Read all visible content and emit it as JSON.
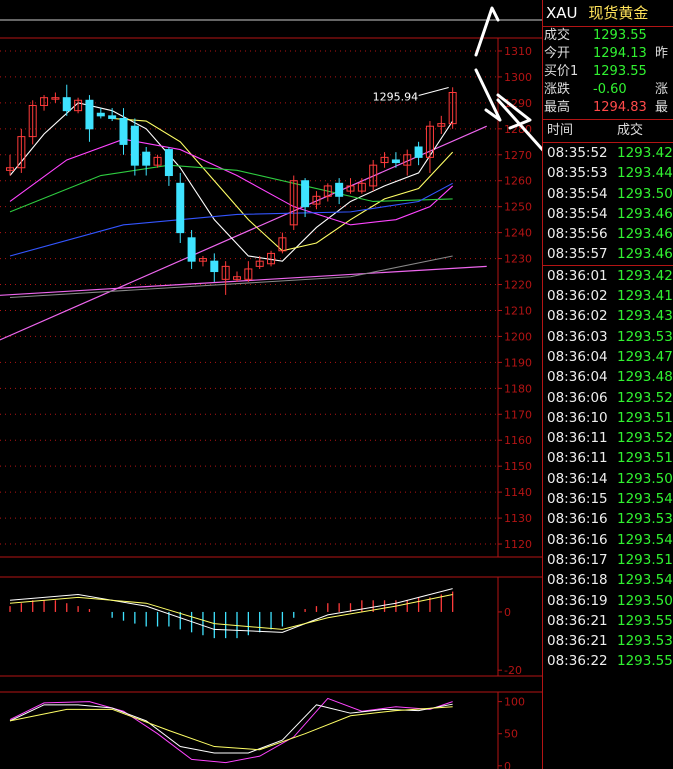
{
  "quote": {
    "symbol": "XAU",
    "name": "现货黄金",
    "rows": [
      {
        "label": "成交",
        "value": "1293.55",
        "extra": "",
        "color": "green"
      },
      {
        "label": "今开",
        "value": "1294.13",
        "extra": "昨",
        "color": "green"
      },
      {
        "label": "买价1",
        "value": "1293.55",
        "extra": "",
        "color": "green"
      },
      {
        "label": "涨跌",
        "value": "-0.60",
        "extra": "涨",
        "color": "green"
      },
      {
        "label": "最高",
        "value": "1294.83",
        "extra": "最",
        "color": "red"
      }
    ]
  },
  "ticks": {
    "header_time": "时间",
    "header_price": "成交",
    "rows": [
      {
        "time": "08:35:52",
        "price": "1293.42"
      },
      {
        "time": "08:35:53",
        "price": "1293.44"
      },
      {
        "time": "08:35:54",
        "price": "1293.50"
      },
      {
        "time": "08:35:54",
        "price": "1293.46"
      },
      {
        "time": "08:35:56",
        "price": "1293.46"
      },
      {
        "time": "08:35:57",
        "price": "1293.46"
      },
      {
        "time": "08:36:01",
        "price": "1293.42"
      },
      {
        "time": "08:36:02",
        "price": "1293.41"
      },
      {
        "time": "08:36:02",
        "price": "1293.43"
      },
      {
        "time": "08:36:03",
        "price": "1293.53"
      },
      {
        "time": "08:36:04",
        "price": "1293.47"
      },
      {
        "time": "08:36:04",
        "price": "1293.48"
      },
      {
        "time": "08:36:06",
        "price": "1293.52"
      },
      {
        "time": "08:36:10",
        "price": "1293.51"
      },
      {
        "time": "08:36:11",
        "price": "1293.52"
      },
      {
        "time": "08:36:11",
        "price": "1293.51"
      },
      {
        "time": "08:36:14",
        "price": "1293.50"
      },
      {
        "time": "08:36:15",
        "price": "1293.54"
      },
      {
        "time": "08:36:16",
        "price": "1293.53"
      },
      {
        "time": "08:36:16",
        "price": "1293.54"
      },
      {
        "time": "08:36:17",
        "price": "1293.51"
      },
      {
        "time": "08:36:18",
        "price": "1293.54"
      },
      {
        "time": "08:36:19",
        "price": "1293.50"
      },
      {
        "time": "08:36:21",
        "price": "1293.55"
      },
      {
        "time": "08:36:21",
        "price": "1293.53"
      },
      {
        "time": "08:36:22",
        "price": "1293.55"
      }
    ]
  },
  "colors": {
    "up": "#ff3b3b",
    "down": "#3fe3ff",
    "grid": "#b31414",
    "ma5": "#ffffff",
    "ma10": "#ffff66",
    "ma20": "#ff44ff",
    "ma30": "#2ecc40",
    "ma60": "#3355ff",
    "ma120": "#888888",
    "trendline": "#ee66ee"
  },
  "chart_data": [
    {
      "type": "candlestick",
      "ylim": [
        1115,
        1315
      ],
      "yticks": [
        1310,
        1300,
        1290,
        1280,
        1270,
        1260,
        1250,
        1240,
        1230,
        1220,
        1210,
        1200,
        1190,
        1180,
        1170,
        1160,
        1150,
        1140,
        1130,
        1120
      ],
      "annotation": "1295.94",
      "annotation_value": 1295.94,
      "candles": [
        {
          "o": 1264,
          "h": 1270,
          "l": 1262,
          "c": 1265
        },
        {
          "o": 1265,
          "h": 1280,
          "l": 1263,
          "c": 1277
        },
        {
          "o": 1277,
          "h": 1291,
          "l": 1274,
          "c": 1289
        },
        {
          "o": 1289,
          "h": 1293,
          "l": 1287,
          "c": 1292
        },
        {
          "o": 1292,
          "h": 1294,
          "l": 1290,
          "c": 1292
        },
        {
          "o": 1292,
          "h": 1297,
          "l": 1285,
          "c": 1287
        },
        {
          "o": 1287,
          "h": 1292,
          "l": 1286,
          "c": 1291
        },
        {
          "o": 1291,
          "h": 1293,
          "l": 1275,
          "c": 1280
        },
        {
          "o": 1286,
          "h": 1288,
          "l": 1284,
          "c": 1285
        },
        {
          "o": 1285,
          "h": 1288,
          "l": 1283,
          "c": 1284
        },
        {
          "o": 1284,
          "h": 1288,
          "l": 1270,
          "c": 1274
        },
        {
          "o": 1281,
          "h": 1284,
          "l": 1262,
          "c": 1266
        },
        {
          "o": 1271,
          "h": 1273,
          "l": 1262,
          "c": 1266
        },
        {
          "o": 1266,
          "h": 1270,
          "l": 1265,
          "c": 1269
        },
        {
          "o": 1272,
          "h": 1273,
          "l": 1258,
          "c": 1262
        },
        {
          "o": 1259,
          "h": 1263,
          "l": 1236,
          "c": 1240
        },
        {
          "o": 1238,
          "h": 1241,
          "l": 1226,
          "c": 1229
        },
        {
          "o": 1229,
          "h": 1231,
          "l": 1227,
          "c": 1230
        },
        {
          "o": 1229,
          "h": 1232,
          "l": 1221,
          "c": 1225
        },
        {
          "o": 1222,
          "h": 1229,
          "l": 1216,
          "c": 1227
        },
        {
          "o": 1222,
          "h": 1225,
          "l": 1221,
          "c": 1223
        },
        {
          "o": 1222,
          "h": 1229,
          "l": 1221,
          "c": 1226
        },
        {
          "o": 1227,
          "h": 1231,
          "l": 1226,
          "c": 1229
        },
        {
          "o": 1228,
          "h": 1233,
          "l": 1227,
          "c": 1232
        },
        {
          "o": 1233,
          "h": 1240,
          "l": 1232,
          "c": 1238
        },
        {
          "o": 1243,
          "h": 1262,
          "l": 1241,
          "c": 1260
        },
        {
          "o": 1260,
          "h": 1261,
          "l": 1246,
          "c": 1250
        },
        {
          "o": 1251,
          "h": 1256,
          "l": 1249,
          "c": 1254
        },
        {
          "o": 1254,
          "h": 1259,
          "l": 1252,
          "c": 1258
        },
        {
          "o": 1259,
          "h": 1261,
          "l": 1251,
          "c": 1254
        },
        {
          "o": 1256,
          "h": 1261,
          "l": 1255,
          "c": 1258
        },
        {
          "o": 1256,
          "h": 1261,
          "l": 1255,
          "c": 1259
        },
        {
          "o": 1258,
          "h": 1268,
          "l": 1256,
          "c": 1266
        },
        {
          "o": 1267,
          "h": 1271,
          "l": 1265,
          "c": 1269
        },
        {
          "o": 1268,
          "h": 1271,
          "l": 1265,
          "c": 1267
        },
        {
          "o": 1266,
          "h": 1272,
          "l": 1262,
          "c": 1270
        },
        {
          "o": 1273,
          "h": 1275,
          "l": 1266,
          "c": 1269
        },
        {
          "o": 1269,
          "h": 1283,
          "l": 1263,
          "c": 1281
        },
        {
          "o": 1281,
          "h": 1285,
          "l": 1278,
          "c": 1282
        },
        {
          "o": 1282,
          "h": 1296,
          "l": 1280,
          "c": 1294
        }
      ],
      "ma": [
        {
          "name": "MA5",
          "key": "ma5",
          "points": [
            [
              0,
              1262
            ],
            [
              3,
              1278
            ],
            [
              6,
              1290
            ],
            [
              9,
              1287
            ],
            [
              12,
              1280
            ],
            [
              15,
              1265
            ],
            [
              18,
              1245
            ],
            [
              21,
              1231
            ],
            [
              24,
              1229
            ],
            [
              27,
              1242
            ],
            [
              30,
              1252
            ],
            [
              33,
              1258
            ],
            [
              36,
              1263
            ],
            [
              39,
              1283
            ]
          ]
        },
        {
          "name": "MA10",
          "key": "ma10",
          "points": [
            [
              9,
              1284
            ],
            [
              12,
              1283
            ],
            [
              15,
              1275
            ],
            [
              18,
              1260
            ],
            [
              21,
              1245
            ],
            [
              24,
              1233
            ],
            [
              27,
              1236
            ],
            [
              30,
              1245
            ],
            [
              33,
              1253
            ],
            [
              36,
              1257
            ],
            [
              39,
              1271
            ]
          ]
        },
        {
          "name": "MA20",
          "key": "ma20",
          "points": [
            [
              0,
              1252
            ],
            [
              5,
              1268
            ],
            [
              10,
              1276
            ],
            [
              15,
              1272
            ],
            [
              20,
              1262
            ],
            [
              25,
              1250
            ],
            [
              30,
              1243
            ],
            [
              34,
              1245
            ],
            [
              37,
              1250
            ],
            [
              39,
              1258
            ]
          ]
        },
        {
          "name": "MA30",
          "key": "ma30",
          "points": [
            [
              0,
              1248
            ],
            [
              8,
              1262
            ],
            [
              14,
              1266
            ],
            [
              20,
              1264
            ],
            [
              26,
              1258
            ],
            [
              32,
              1252
            ],
            [
              39,
              1253
            ]
          ]
        },
        {
          "name": "MA60",
          "key": "ma60",
          "points": [
            [
              0,
              1231
            ],
            [
              10,
              1243
            ],
            [
              20,
              1247
            ],
            [
              30,
              1248
            ],
            [
              36,
              1252
            ],
            [
              39,
              1259
            ]
          ]
        },
        {
          "name": "MA120",
          "key": "ma120",
          "points": [
            [
              0,
              1215
            ],
            [
              15,
              1219
            ],
            [
              30,
              1223
            ],
            [
              39,
              1231
            ]
          ]
        }
      ],
      "trendlines": [
        {
          "from": [
            -8,
            1185
          ],
          "to": [
            42,
            1281
          ]
        },
        {
          "from": [
            -8,
            1214
          ],
          "to": [
            42,
            1227
          ]
        }
      ]
    },
    {
      "type": "bar",
      "indicator": "MACD",
      "ylim": [
        -22,
        12
      ],
      "yticks": [
        0,
        -20
      ],
      "values": [
        2,
        3,
        4,
        4,
        4,
        3,
        2,
        1,
        0,
        -2,
        -3,
        -4,
        -5,
        -5,
        -5,
        -6,
        -7,
        -8,
        -9,
        -9,
        -9,
        -8,
        -7,
        -6,
        -5,
        -2,
        1,
        2,
        3,
        3,
        3,
        4,
        4,
        4,
        4,
        4,
        5,
        5,
        6,
        7
      ],
      "dif": [
        [
          0,
          4
        ],
        [
          6,
          6
        ],
        [
          12,
          2
        ],
        [
          18,
          -6
        ],
        [
          24,
          -7
        ],
        [
          28,
          -1
        ],
        [
          34,
          3
        ],
        [
          39,
          8
        ]
      ],
      "dea": [
        [
          0,
          3
        ],
        [
          6,
          5
        ],
        [
          12,
          3
        ],
        [
          18,
          -4
        ],
        [
          24,
          -6
        ],
        [
          28,
          -2
        ],
        [
          34,
          2
        ],
        [
          39,
          6
        ]
      ]
    },
    {
      "type": "line",
      "indicator": "KDJ",
      "ylim": [
        -5,
        115
      ],
      "yticks": [
        100,
        50,
        0
      ],
      "k": [
        [
          0,
          70
        ],
        [
          3,
          95
        ],
        [
          6,
          95
        ],
        [
          9,
          90
        ],
        [
          12,
          70
        ],
        [
          15,
          30
        ],
        [
          18,
          20
        ],
        [
          21,
          20
        ],
        [
          24,
          40
        ],
        [
          27,
          95
        ],
        [
          30,
          82
        ],
        [
          33,
          88
        ],
        [
          36,
          86
        ],
        [
          39,
          96
        ]
      ],
      "d": [
        [
          0,
          70
        ],
        [
          5,
          88
        ],
        [
          9,
          88
        ],
        [
          14,
          55
        ],
        [
          18,
          30
        ],
        [
          22,
          25
        ],
        [
          26,
          50
        ],
        [
          30,
          78
        ],
        [
          34,
          86
        ],
        [
          39,
          92
        ]
      ],
      "j": [
        [
          0,
          72
        ],
        [
          3,
          98
        ],
        [
          7,
          100
        ],
        [
          10,
          85
        ],
        [
          13,
          50
        ],
        [
          16,
          10
        ],
        [
          19,
          5
        ],
        [
          22,
          15
        ],
        [
          25,
          45
        ],
        [
          28,
          105
        ],
        [
          31,
          85
        ],
        [
          34,
          92
        ],
        [
          37,
          88
        ],
        [
          39,
          100
        ]
      ]
    }
  ]
}
